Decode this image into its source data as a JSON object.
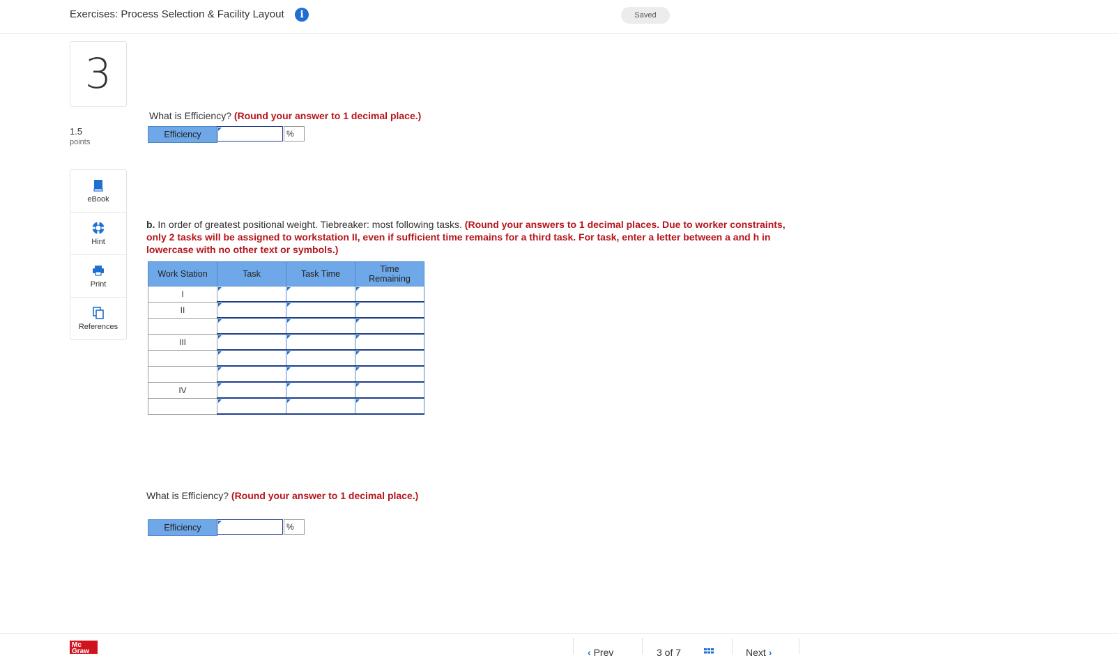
{
  "header": {
    "title": "Exercises: Process Selection & Facility Layout",
    "saved_label": "Saved",
    "info_icon": "i"
  },
  "question": {
    "number": "3",
    "points_value": "1.5",
    "points_label": "points"
  },
  "tools": [
    {
      "icon": "book-icon",
      "label": "eBook"
    },
    {
      "icon": "lifebuoy-icon",
      "label": "Hint"
    },
    {
      "icon": "printer-icon",
      "label": "Print"
    },
    {
      "icon": "copy-pages-icon",
      "label": "References"
    }
  ],
  "part_a_efficiency": {
    "question": "What is Efficiency?",
    "instruction": "(Round your answer to 1 decimal place.)",
    "label": "Efficiency",
    "value": "",
    "unit": "%"
  },
  "part_b": {
    "lead": "b.",
    "text": "In order of greatest positional weight. Tiebreaker: most following tasks.",
    "instruction": "(Round your answers to 1 decimal places. Due to worker constraints, only 2 tasks will be assigned to workstation II, even if sufficient time remains for a third task. For task, enter a letter between a and h in lowercase with no other text or symbols.)",
    "columns": [
      "Work Station",
      "Task",
      "Task Time",
      "Time Remaining"
    ],
    "rows": [
      {
        "station": "I"
      },
      {
        "station": "II"
      },
      {
        "station": ""
      },
      {
        "station": "III"
      },
      {
        "station": ""
      },
      {
        "station": ""
      },
      {
        "station": "IV"
      },
      {
        "station": ""
      }
    ]
  },
  "part_b_efficiency": {
    "question": "What is Efficiency?",
    "instruction": "(Round your answer to 1 decimal place.)",
    "label": "Efficiency",
    "value": "",
    "unit": "%"
  },
  "footer": {
    "logo_line1": "Mc",
    "logo_line2": "Graw",
    "prev_label": "Prev",
    "page_indicator": "3 of 7",
    "next_label": "Next"
  }
}
